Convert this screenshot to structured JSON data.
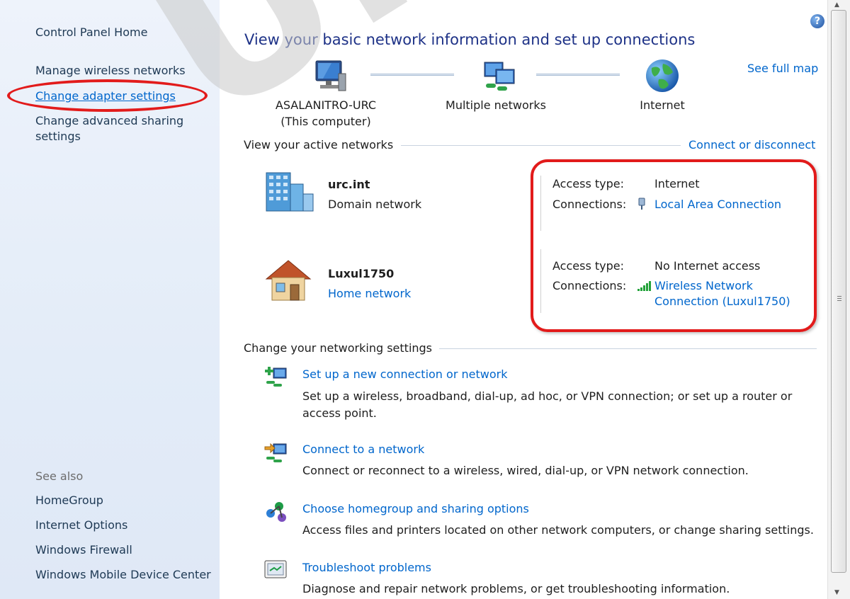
{
  "sidebar": {
    "home": "Control Panel Home",
    "manage_wireless": "Manage wireless networks",
    "change_adapter": "Change adapter settings",
    "change_sharing_1": "Change advanced sharing",
    "change_sharing_2": "settings",
    "see_also": "See also",
    "see_also_links": [
      "HomeGroup",
      "Internet Options",
      "Windows Firewall",
      "Windows Mobile Device Center"
    ]
  },
  "help_icon": "?",
  "main": {
    "title": "View your basic network information and set up connections",
    "see_full_map": "See full map",
    "map": {
      "computer_name": "ASALANITRO-URC",
      "computer_sub": "(This computer)",
      "middle": "Multiple networks",
      "internet": "Internet"
    },
    "active_header": "View your active networks",
    "connect_disconnect": "Connect or disconnect",
    "networks": [
      {
        "name": "urc.int",
        "category": "Domain network",
        "access_label": "Access type:",
        "access_value": "Internet",
        "conn_label": "Connections:",
        "conn_value": "Local Area Connection"
      },
      {
        "name": "Luxul1750",
        "category": "Home network",
        "access_label": "Access type:",
        "access_value": "No Internet access",
        "conn_label": "Connections:",
        "conn_value_1": "Wireless Network",
        "conn_value_2": "Connection (Luxul1750)"
      }
    ],
    "settings_header": "Change your networking settings",
    "tasks": [
      {
        "title": "Set up a new connection or network",
        "desc_1": "Set up a wireless, broadband, dial-up, ad hoc, or VPN connection; or set up a router or",
        "desc_2": "access point."
      },
      {
        "title": "Connect to a network",
        "desc_1": "Connect or reconnect to a wireless, wired, dial-up, or VPN network connection."
      },
      {
        "title": "Choose homegroup and sharing options",
        "desc_1": "Access files and printers located on other network computers, or change sharing settings."
      },
      {
        "title": "Troubleshoot problems",
        "desc_1": "Diagnose and repair network problems, or get troubleshooting information."
      }
    ]
  },
  "watermark": "URC",
  "colors": {
    "link": "#0066cc",
    "title": "#1e3287",
    "annotation": "#e21b1b"
  }
}
